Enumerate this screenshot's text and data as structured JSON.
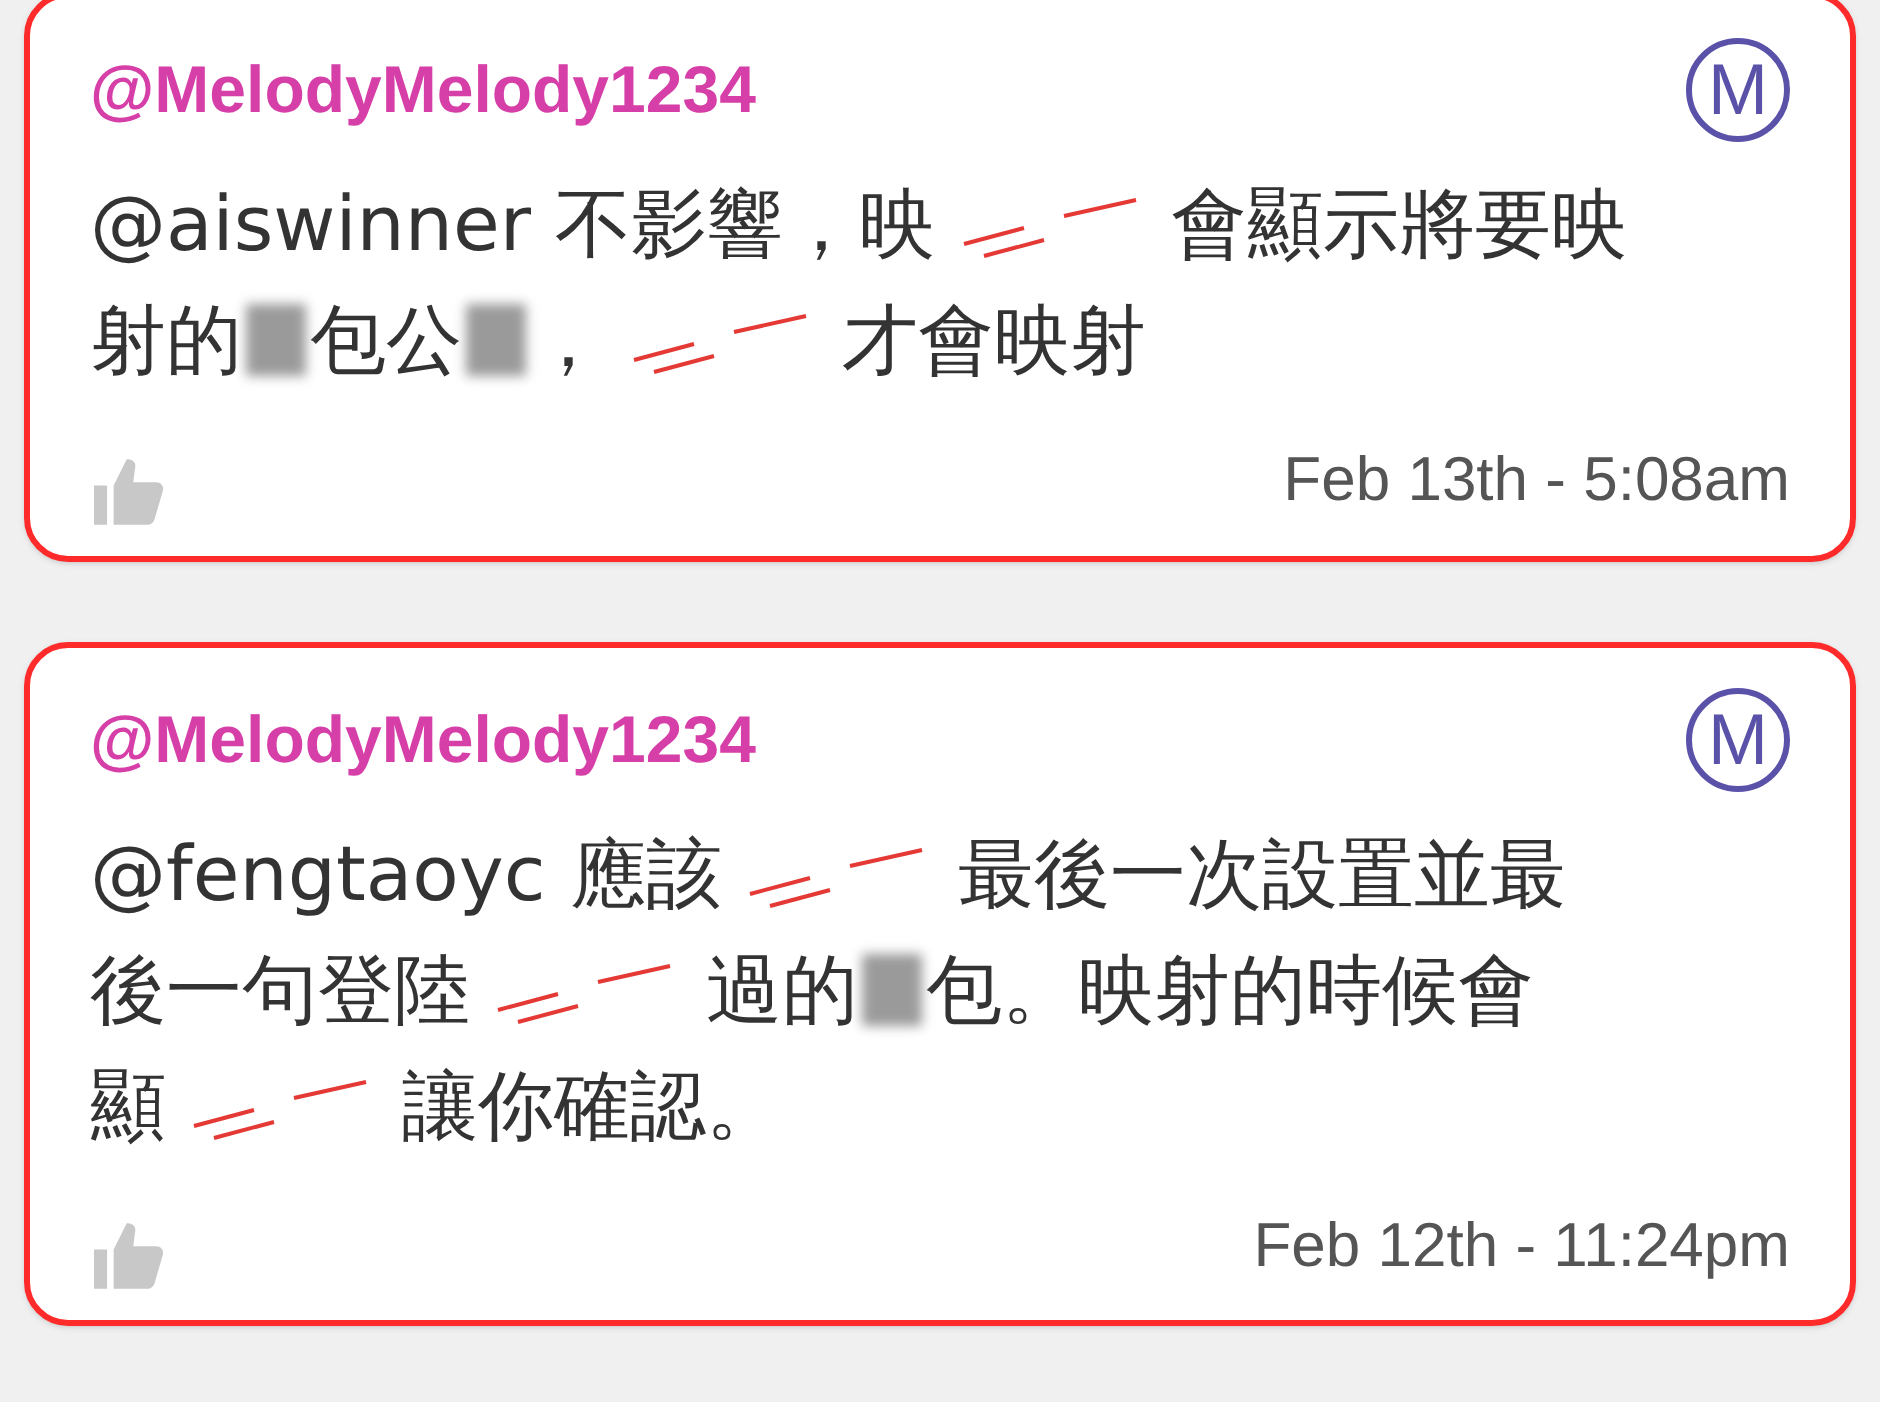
{
  "comments": [
    {
      "author": "@MelodyMelody1234",
      "avatar": "M",
      "lines": [
        [
          {
            "kind": "text",
            "text": "@aiswinner 不影響，映"
          },
          {
            "kind": "redacted"
          },
          {
            "kind": "text",
            "text": "會顯示將要映"
          }
        ],
        [
          {
            "kind": "text",
            "text": "射的"
          },
          {
            "kind": "blurred"
          },
          {
            "kind": "text",
            "text": "包公"
          },
          {
            "kind": "blurred"
          },
          {
            "kind": "text",
            "text": "，"
          },
          {
            "kind": "redacted"
          },
          {
            "kind": "text",
            "text": "才會映射"
          }
        ]
      ],
      "time": "Feb 13th - 5:08am"
    },
    {
      "author": "@MelodyMelody1234",
      "avatar": "M",
      "lines": [
        [
          {
            "kind": "text",
            "text": "@fengtaoyc 應該"
          },
          {
            "kind": "redacted"
          },
          {
            "kind": "text",
            "text": "最後一次設置並最"
          }
        ],
        [
          {
            "kind": "text",
            "text": "後一句登陸"
          },
          {
            "kind": "redacted"
          },
          {
            "kind": "text",
            "text": "過的"
          },
          {
            "kind": "blurred"
          },
          {
            "kind": "text",
            "text": "包。映射的時候會"
          }
        ],
        [
          {
            "kind": "text",
            "text": "顯"
          },
          {
            "kind": "redacted"
          },
          {
            "kind": "text",
            "text": "讓你確認。"
          }
        ]
      ],
      "time": "Feb 12th - 11:24pm"
    }
  ]
}
